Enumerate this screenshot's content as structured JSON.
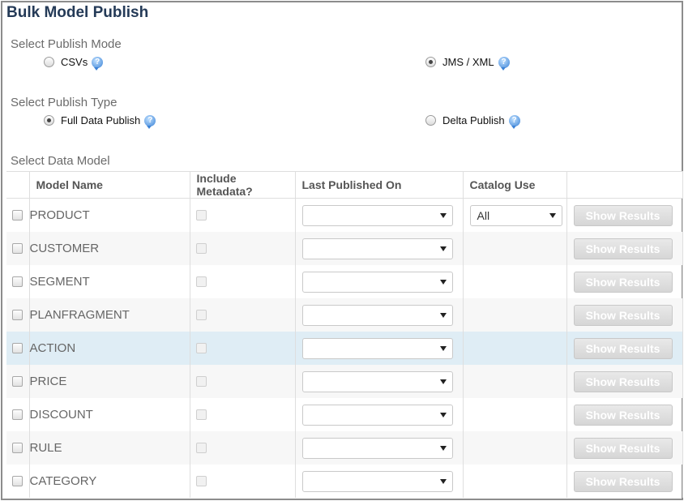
{
  "page": {
    "title": "Bulk Model Publish"
  },
  "publish_mode": {
    "label": "Select Publish Mode",
    "options": [
      {
        "label": "CSVs",
        "selected": false
      },
      {
        "label": "JMS / XML",
        "selected": true
      }
    ]
  },
  "publish_type": {
    "label": "Select Publish Type",
    "options": [
      {
        "label": "Full Data Publish",
        "selected": true
      },
      {
        "label": "Delta Publish",
        "selected": false
      }
    ]
  },
  "data_model": {
    "label": "Select Data Model",
    "columns": [
      "",
      "Model Name",
      "Include Metadata?",
      "Last Published On",
      "Catalog Use",
      ""
    ],
    "rows": [
      {
        "name": "PRODUCT",
        "last_published": "",
        "catalog_use": "All",
        "button": "Show Results"
      },
      {
        "name": "CUSTOMER",
        "last_published": "",
        "catalog_use": "",
        "button": "Show Results"
      },
      {
        "name": "SEGMENT",
        "last_published": "",
        "catalog_use": "",
        "button": "Show Results"
      },
      {
        "name": "PLANFRAGMENT",
        "last_published": "",
        "catalog_use": "",
        "button": "Show Results"
      },
      {
        "name": "ACTION",
        "last_published": "",
        "catalog_use": "",
        "button": "Show Results"
      },
      {
        "name": "PRICE",
        "last_published": "",
        "catalog_use": "",
        "button": "Show Results"
      },
      {
        "name": "DISCOUNT",
        "last_published": "",
        "catalog_use": "",
        "button": "Show Results"
      },
      {
        "name": "RULE",
        "last_published": "",
        "catalog_use": "",
        "button": "Show Results"
      },
      {
        "name": "CATEGORY",
        "last_published": "",
        "catalog_use": "",
        "button": "Show Results"
      }
    ]
  },
  "help_icon_glyph": "?"
}
